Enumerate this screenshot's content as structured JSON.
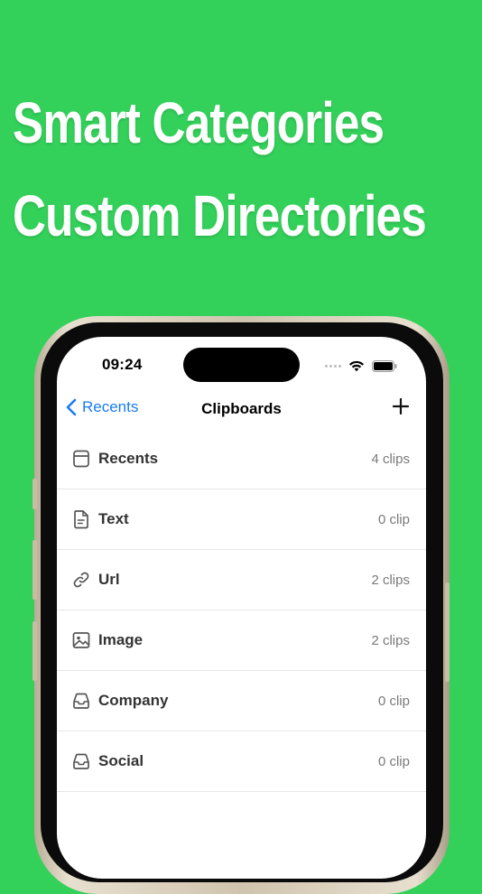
{
  "headline": {
    "line1": "Smart Categories",
    "line2": "Custom Directories"
  },
  "colors": {
    "background": "#33D05A",
    "accent": "#1A7BF2",
    "phone_frame": "#CFC4AD"
  },
  "status_bar": {
    "time": "09:24",
    "icons": [
      "signal-dots-icon",
      "wifi-icon",
      "battery-icon"
    ]
  },
  "nav": {
    "back_label": "Recents",
    "title": "Clipboards",
    "add_icon": "plus-icon"
  },
  "rows": [
    {
      "label": "Recents",
      "count": "4 clips",
      "icon": "clipboard-icon"
    },
    {
      "label": "Text",
      "count": "0 clip",
      "icon": "document-text-icon"
    },
    {
      "label": "Url",
      "count": "2 clips",
      "icon": "link-icon"
    },
    {
      "label": "Image",
      "count": "2 clips",
      "icon": "image-icon"
    },
    {
      "label": "Company",
      "count": "0 clip",
      "icon": "tray-icon"
    },
    {
      "label": "Social",
      "count": "0 clip",
      "icon": "tray-icon"
    }
  ]
}
